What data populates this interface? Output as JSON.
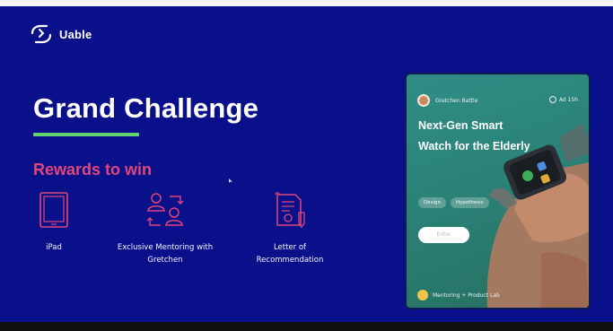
{
  "brand": {
    "name": "Uable",
    "icon": "uable-logo-icon"
  },
  "slide": {
    "title": "Grand Challenge",
    "rewards_heading": "Rewards to win",
    "rewards": [
      {
        "icon": "ipad-icon",
        "label": "iPad"
      },
      {
        "icon": "mentoring-icon",
        "label_line1": "Exclusive Mentoring with",
        "label_line2": "Gretchen"
      },
      {
        "icon": "letter-icon",
        "label_line1": "Letter of",
        "label_line2": "Recommendation"
      }
    ]
  },
  "card": {
    "author": "Gretchen Battle",
    "timer": "Ad 15h",
    "title_line1": "Next-Gen Smart",
    "title_line2": "Watch for the Elderly",
    "tags": [
      "Design",
      "Hypothesis"
    ],
    "enter_label": "Enter",
    "footer": "Mentoring + Product Lab"
  },
  "colors": {
    "background": "#0a0f8a",
    "accent_green": "#63d36c",
    "accent_pink": "#e0467a",
    "card_teal": "#2b8277"
  }
}
